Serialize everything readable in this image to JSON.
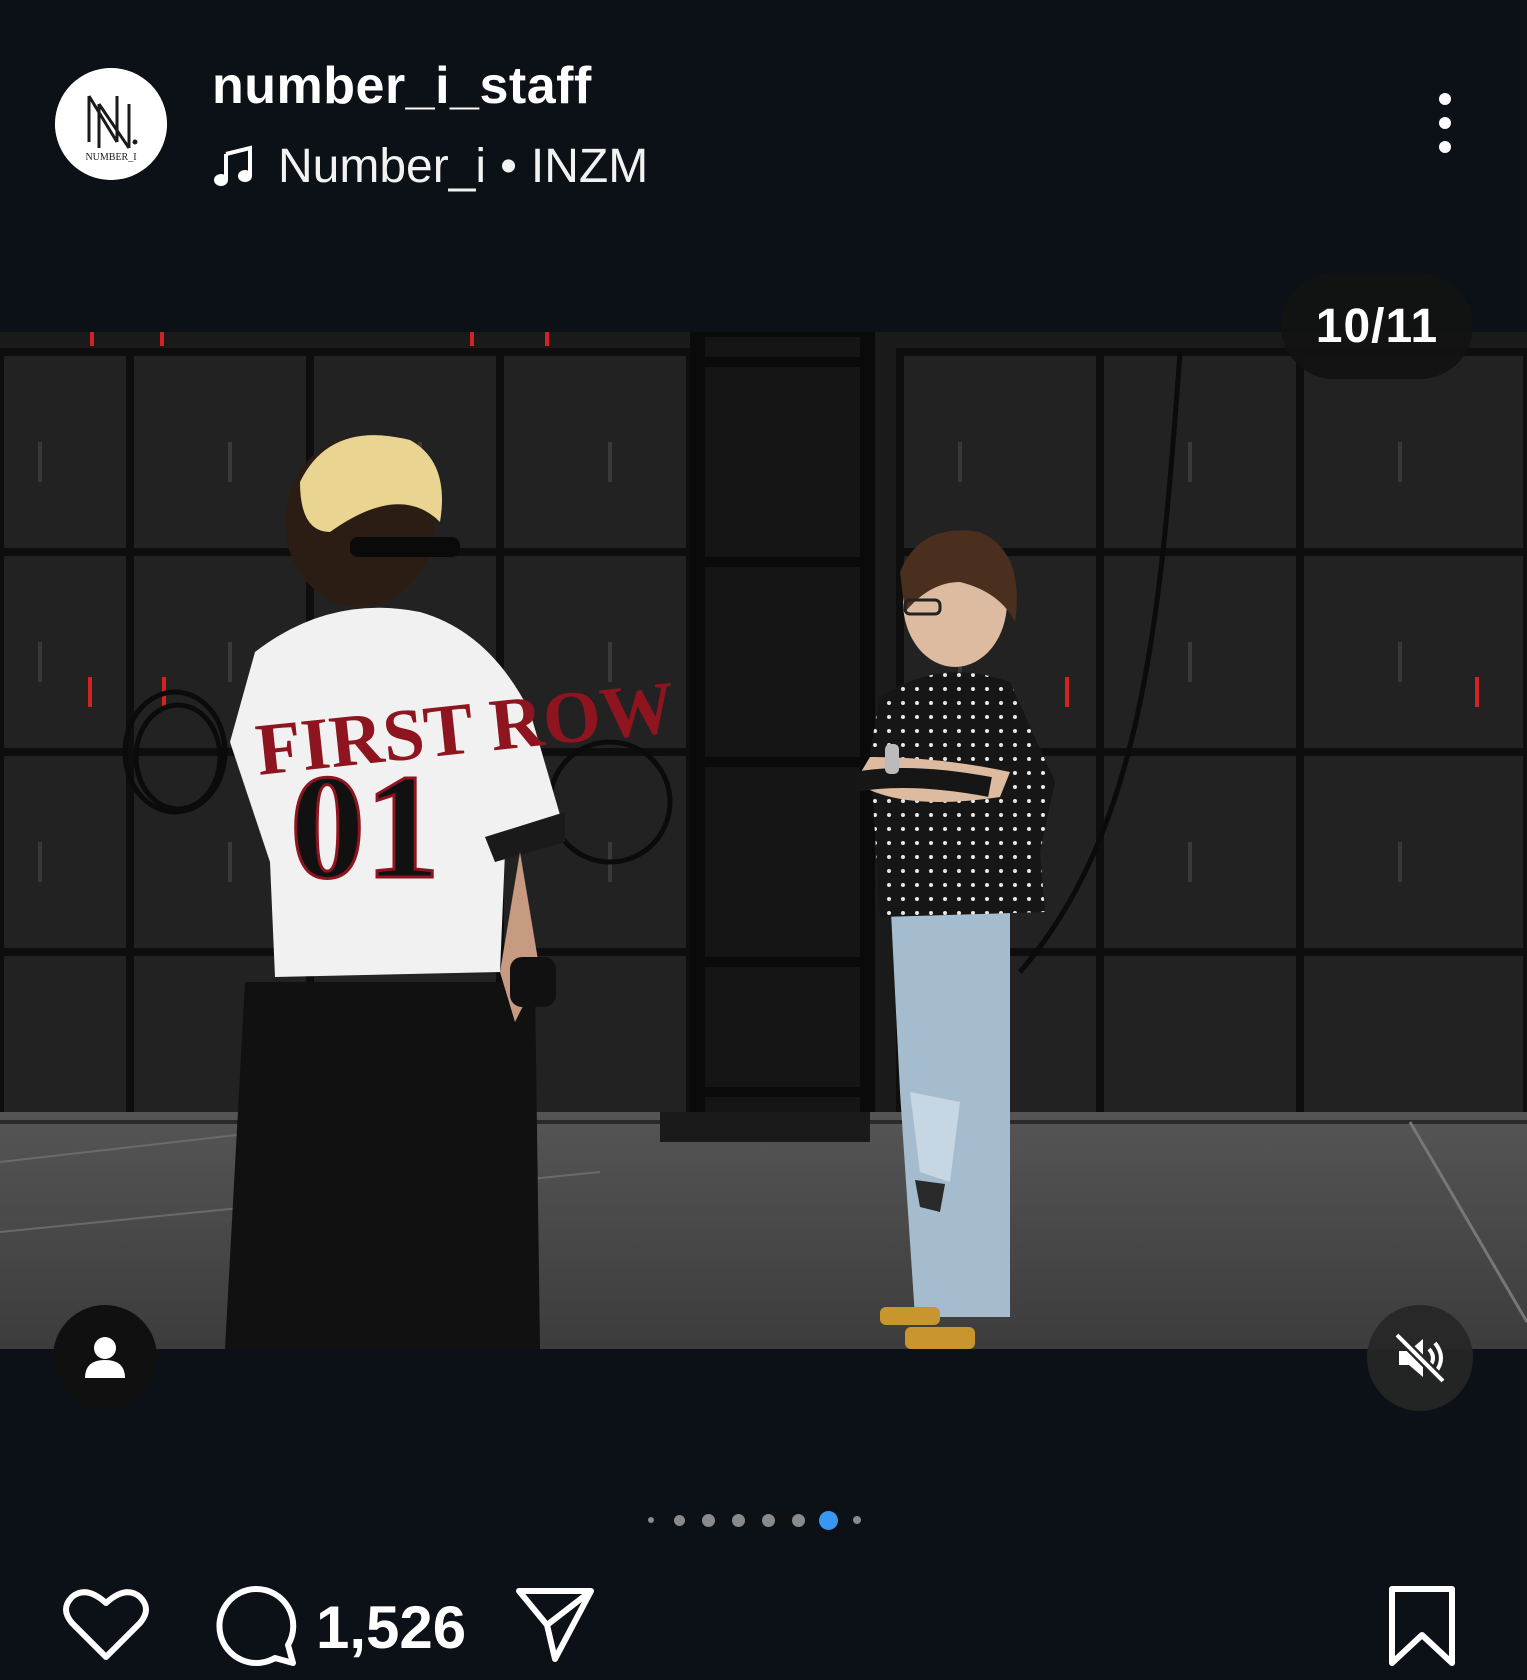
{
  "post": {
    "username": "number_i_staff",
    "avatar_text": "NUMBER_I",
    "audio": {
      "icon": "music-note-icon",
      "artist": "Number_i",
      "separator": "•",
      "track": "INZM"
    },
    "more_icon": "more-vertical-icon"
  },
  "media": {
    "counter": "10/11",
    "tag_icon": "person-icon",
    "mute_icon": "speaker-muted-icon",
    "jersey_text_top": "FIRST ROW",
    "jersey_text_number": "01"
  },
  "pagination": {
    "total_visible": 8,
    "active_index": 6,
    "active_color": "#3897f0",
    "inactive_color": "#8a8a8a"
  },
  "actions": {
    "like_icon": "heart-icon",
    "comment_icon": "comment-icon",
    "comment_count": "1,526",
    "share_icon": "send-icon",
    "save_icon": "bookmark-icon"
  }
}
